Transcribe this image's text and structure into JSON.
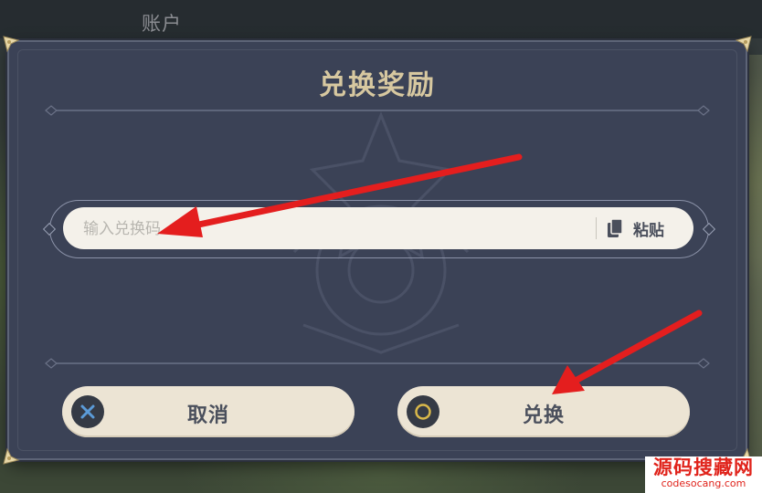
{
  "header": {
    "account_label": "账户"
  },
  "dialog": {
    "title": "兑换奖励",
    "input": {
      "placeholder": "输入兑换码",
      "value": ""
    },
    "paste_label": "粘贴",
    "cancel_label": "取消",
    "redeem_label": "兑换"
  },
  "watermark": {
    "main": "源码搜藏网",
    "sub": "codesocang.com"
  },
  "colors": {
    "dialog_bg": "#3b4256",
    "title": "#d7c8a0",
    "button_bg": "#ece4d4",
    "cancel_icon": "#5b9bd8",
    "redeem_icon": "#d9b84a",
    "annotation_arrow": "#e41e1e"
  },
  "icons": {
    "cancel": "cross-icon",
    "redeem": "circle-icon",
    "paste": "clipboard-icon"
  }
}
